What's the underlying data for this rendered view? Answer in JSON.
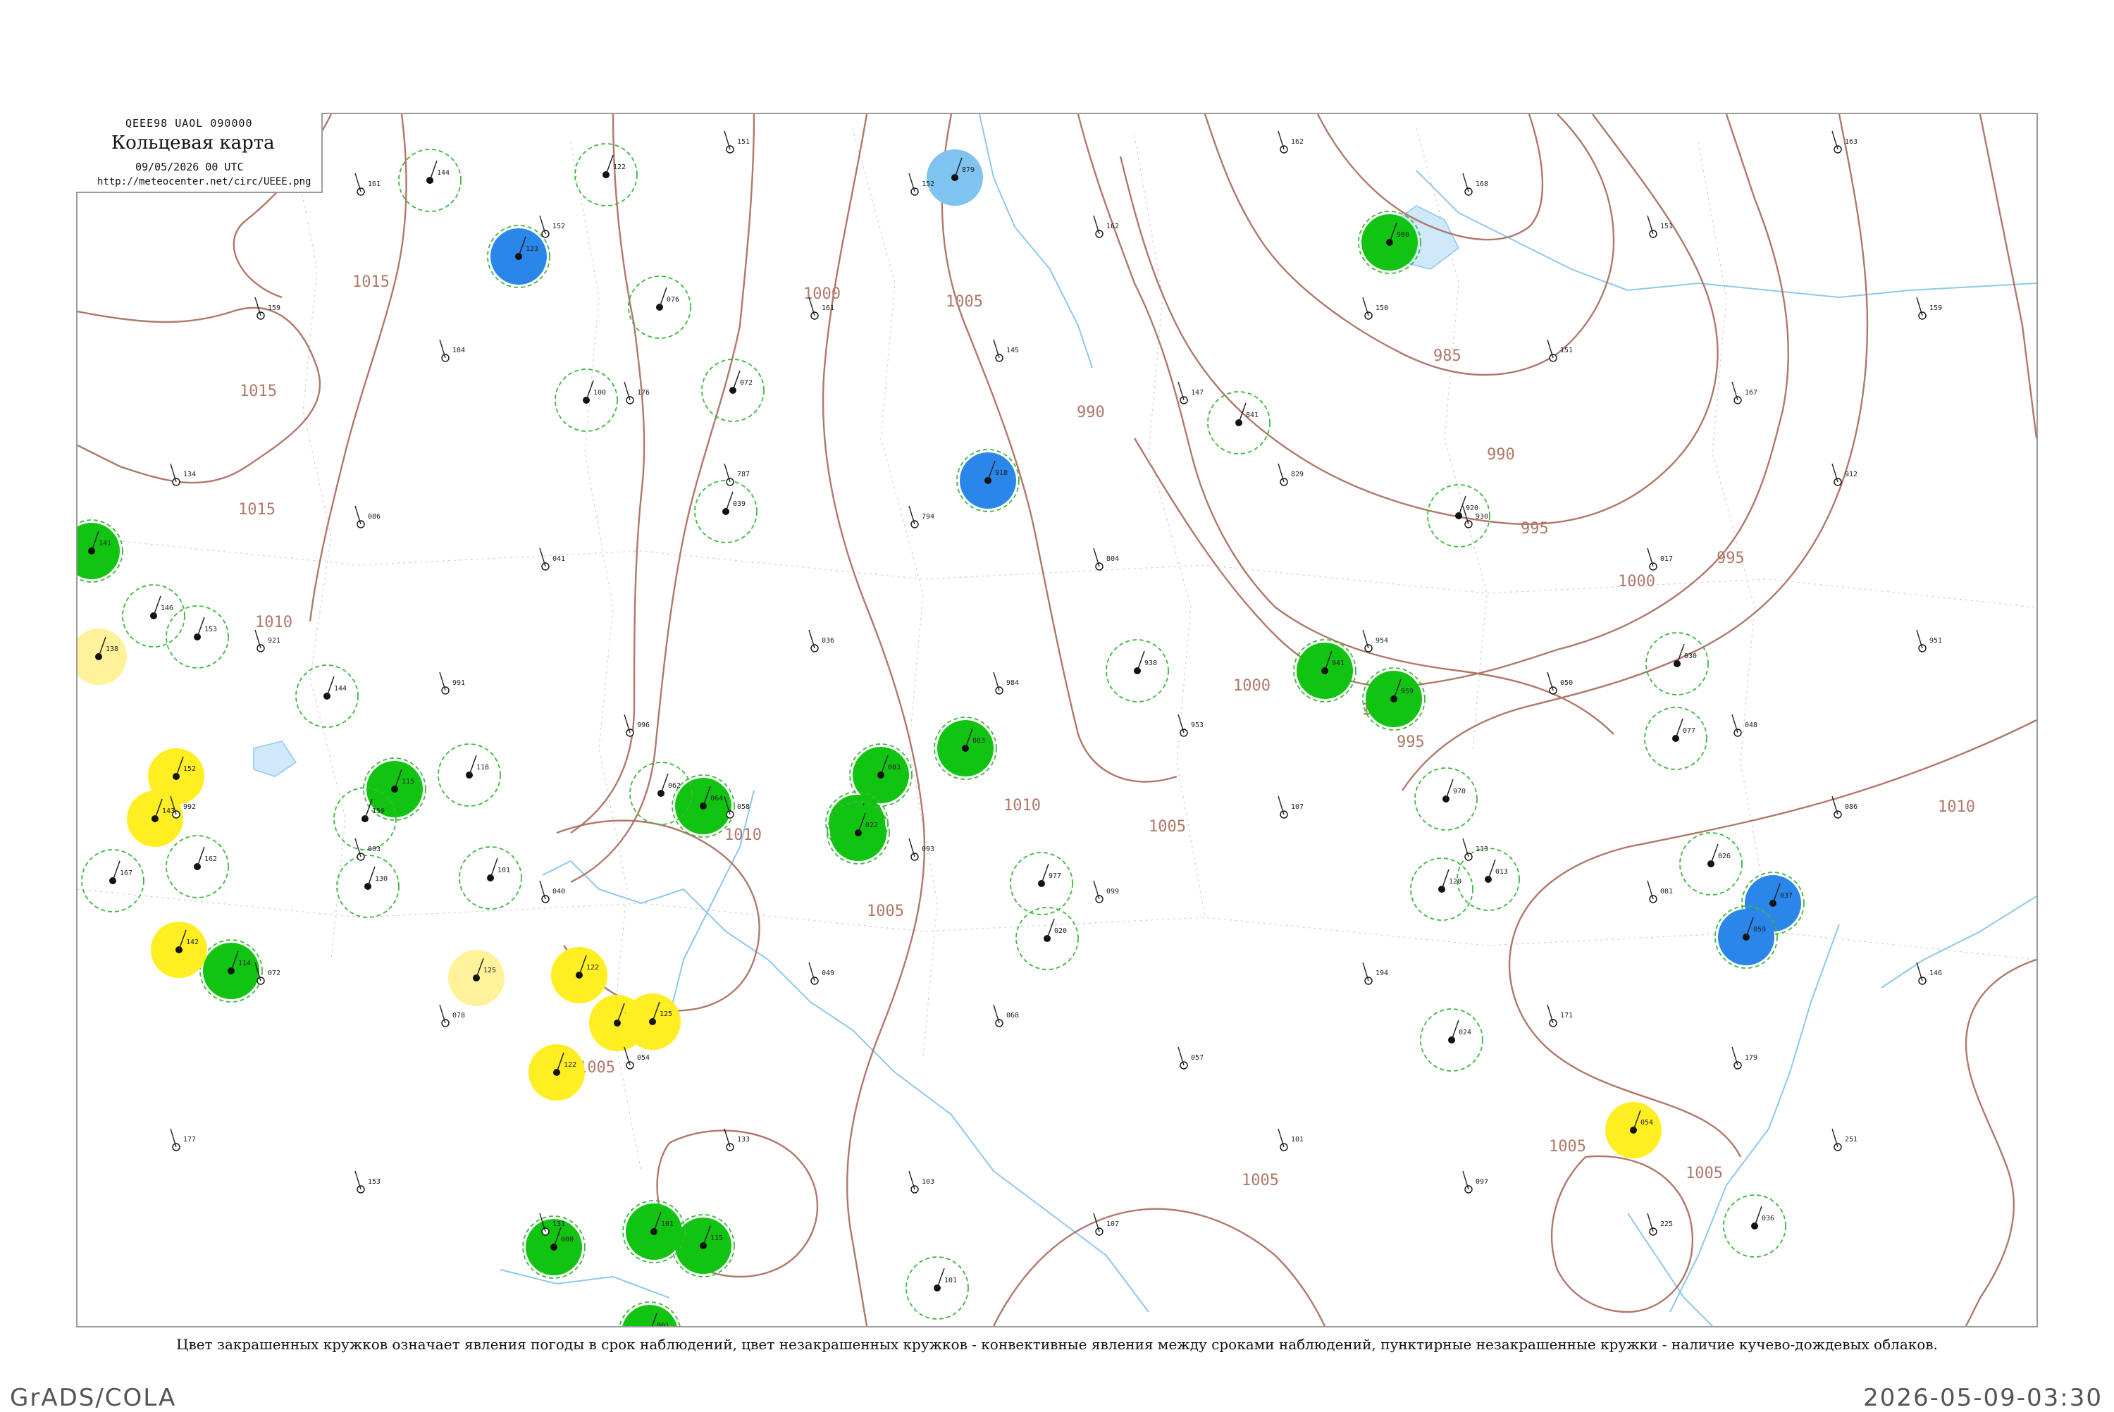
{
  "header": {
    "code": "QEEE98 UAOL 090000",
    "title": "Кольцевая карта",
    "datetime": "09/05/2026 00 UTC",
    "url": "http://meteocenter.net/circ/UEEE.png"
  },
  "caption": "Цвет закрашенных кружков означает явления погоды в срок наблюдений, цвет незакрашенных кружков - конвективные явления между сроками наблюдений, пунктирные незакрашенные кружки - наличие кучево-дождевых облаков.",
  "footer": {
    "left": "GrADS/COLA",
    "right": "2026-05-09-03:30"
  },
  "colors": {
    "rain": "#11c411",
    "snow": "#2a86e8",
    "fog": "#ffee22",
    "haze": "#fff29a",
    "thunder_light": "#7fc4f0",
    "isobar": "#b0786a",
    "ring": "#3db83d"
  },
  "isobar_labels": [
    {
      "text": "1015"
    },
    {
      "text": "1015"
    },
    {
      "text": "1015"
    },
    {
      "text": "1010"
    },
    {
      "text": "1000"
    },
    {
      "text": "1005"
    },
    {
      "text": "985"
    },
    {
      "text": "990"
    },
    {
      "text": "990"
    },
    {
      "text": "995"
    },
    {
      "text": "995"
    },
    {
      "text": "1000"
    },
    {
      "text": "1005"
    },
    {
      "text": "1000"
    },
    {
      "text": "995"
    },
    {
      "text": "1010"
    },
    {
      "text": "1000"
    },
    {
      "text": "1005"
    },
    {
      "text": "1010"
    },
    {
      "text": "1005"
    },
    {
      "text": "1005"
    },
    {
      "text": "1005"
    },
    {
      "text": "1010"
    },
    {
      "text": "1005"
    }
  ],
  "stations": [
    {
      "type": "rain",
      "value": "141",
      "ring": true
    },
    {
      "type": "rain",
      "value": "115",
      "ring": true
    },
    {
      "type": "rain",
      "value": "114",
      "ring": true
    },
    {
      "type": "rain",
      "value": "003",
      "ring": true
    },
    {
      "type": "rain",
      "value": "941",
      "ring": true
    },
    {
      "type": "rain",
      "value": "959",
      "ring": true
    },
    {
      "type": "rain",
      "value": "980",
      "ring": true
    },
    {
      "type": "rain",
      "value": "012",
      "ring": true
    },
    {
      "type": "rain",
      "value": "022",
      "ring": true
    },
    {
      "type": "rain",
      "value": "083",
      "ring": true
    },
    {
      "type": "rain",
      "value": "064",
      "ring": true
    },
    {
      "type": "rain",
      "value": "115",
      "ring": true
    },
    {
      "type": "rain",
      "value": "008",
      "ring": true
    },
    {
      "type": "rain",
      "value": "101",
      "ring": true
    },
    {
      "type": "rain",
      "value": "001",
      "ring": true
    },
    {
      "type": "snow",
      "value": "123",
      "ring": true
    },
    {
      "type": "snow",
      "value": "918",
      "ring": true
    },
    {
      "type": "snow",
      "value": "037",
      "ring": true
    },
    {
      "type": "snow",
      "value": "059",
      "ring": true
    },
    {
      "type": "thunder_light",
      "value": "879",
      "ring": false
    },
    {
      "type": "fog",
      "value": "152",
      "ring": false
    },
    {
      "type": "fog",
      "value": "143",
      "ring": false
    },
    {
      "type": "fog",
      "value": "142",
      "ring": false
    },
    {
      "type": "fog",
      "value": "122",
      "ring": false
    },
    {
      "type": "fog",
      "value": "135",
      "ring": false
    },
    {
      "type": "fog",
      "value": "125",
      "ring": false
    },
    {
      "type": "fog",
      "value": "122",
      "ring": false
    },
    {
      "type": "fog",
      "value": "054",
      "ring": false
    },
    {
      "type": "haze",
      "value": "138",
      "ring": false
    },
    {
      "type": "haze",
      "value": "125",
      "ring": false
    },
    {
      "type": "ring",
      "value": "144",
      "ring": true
    },
    {
      "type": "ring",
      "value": "122",
      "ring": true
    },
    {
      "type": "ring",
      "value": "100",
      "ring": true
    },
    {
      "type": "ring",
      "value": "076",
      "ring": true
    },
    {
      "type": "ring",
      "value": "072",
      "ring": true
    },
    {
      "type": "ring",
      "value": "039",
      "ring": true
    },
    {
      "type": "ring",
      "value": "146",
      "ring": true
    },
    {
      "type": "ring",
      "value": "153",
      "ring": true
    },
    {
      "type": "ring",
      "value": "144",
      "ring": true
    },
    {
      "type": "ring",
      "value": "118",
      "ring": true
    },
    {
      "type": "ring",
      "value": "101",
      "ring": true
    },
    {
      "type": "ring",
      "value": "062",
      "ring": true
    },
    {
      "type": "ring",
      "value": "977",
      "ring": true
    },
    {
      "type": "ring",
      "value": "020",
      "ring": true
    },
    {
      "type": "ring",
      "value": "938",
      "ring": true
    },
    {
      "type": "ring",
      "value": "920",
      "ring": true
    },
    {
      "type": "ring",
      "value": "841",
      "ring": true
    },
    {
      "type": "ring",
      "value": "970",
      "ring": true
    },
    {
      "type": "ring",
      "value": "013",
      "ring": true
    },
    {
      "type": "ring",
      "value": "024",
      "ring": true
    },
    {
      "type": "ring",
      "value": "030",
      "ring": true
    },
    {
      "type": "ring",
      "value": "077",
      "ring": true
    },
    {
      "type": "ring",
      "value": "026",
      "ring": true
    },
    {
      "type": "ring",
      "value": "036",
      "ring": true
    },
    {
      "type": "ring",
      "value": "120",
      "ring": true
    },
    {
      "type": "ring",
      "value": "159",
      "ring": true
    },
    {
      "type": "ring",
      "value": "167",
      "ring": true
    },
    {
      "type": "ring",
      "value": "162",
      "ring": true
    },
    {
      "type": "ring",
      "value": "130",
      "ring": true
    },
    {
      "type": "ring",
      "value": "101",
      "ring": true
    }
  ],
  "plain_stations": [
    {
      "value": "158"
    },
    {
      "value": "161"
    },
    {
      "value": "152"
    },
    {
      "value": "151"
    },
    {
      "value": "152"
    },
    {
      "value": "162"
    },
    {
      "value": "162"
    },
    {
      "value": "168"
    },
    {
      "value": "151"
    },
    {
      "value": "163"
    },
    {
      "value": "159"
    },
    {
      "value": "184"
    },
    {
      "value": "176"
    },
    {
      "value": "161"
    },
    {
      "value": "145"
    },
    {
      "value": "147"
    },
    {
      "value": "150"
    },
    {
      "value": "151"
    },
    {
      "value": "167"
    },
    {
      "value": "159"
    },
    {
      "value": "134"
    },
    {
      "value": "086"
    },
    {
      "value": "041"
    },
    {
      "value": "787"
    },
    {
      "value": "794"
    },
    {
      "value": "804"
    },
    {
      "value": "829"
    },
    {
      "value": "930"
    },
    {
      "value": "017"
    },
    {
      "value": "912"
    },
    {
      "value": "921"
    },
    {
      "value": "991"
    },
    {
      "value": "996"
    },
    {
      "value": "036"
    },
    {
      "value": "984"
    },
    {
      "value": "953"
    },
    {
      "value": "954"
    },
    {
      "value": "050"
    },
    {
      "value": "048"
    },
    {
      "value": "951"
    },
    {
      "value": "992"
    },
    {
      "value": "003"
    },
    {
      "value": "040"
    },
    {
      "value": "058"
    },
    {
      "value": "093"
    },
    {
      "value": "099"
    },
    {
      "value": "107"
    },
    {
      "value": "113"
    },
    {
      "value": "081"
    },
    {
      "value": "086"
    },
    {
      "value": "072"
    },
    {
      "value": "078"
    },
    {
      "value": "054"
    },
    {
      "value": "049"
    },
    {
      "value": "068"
    },
    {
      "value": "057"
    },
    {
      "value": "194"
    },
    {
      "value": "171"
    },
    {
      "value": "179"
    },
    {
      "value": "146"
    },
    {
      "value": "177"
    },
    {
      "value": "153"
    },
    {
      "value": "131"
    },
    {
      "value": "133"
    },
    {
      "value": "103"
    },
    {
      "value": "107"
    },
    {
      "value": "101"
    },
    {
      "value": "097"
    },
    {
      "value": "225"
    },
    {
      "value": "251"
    }
  ]
}
